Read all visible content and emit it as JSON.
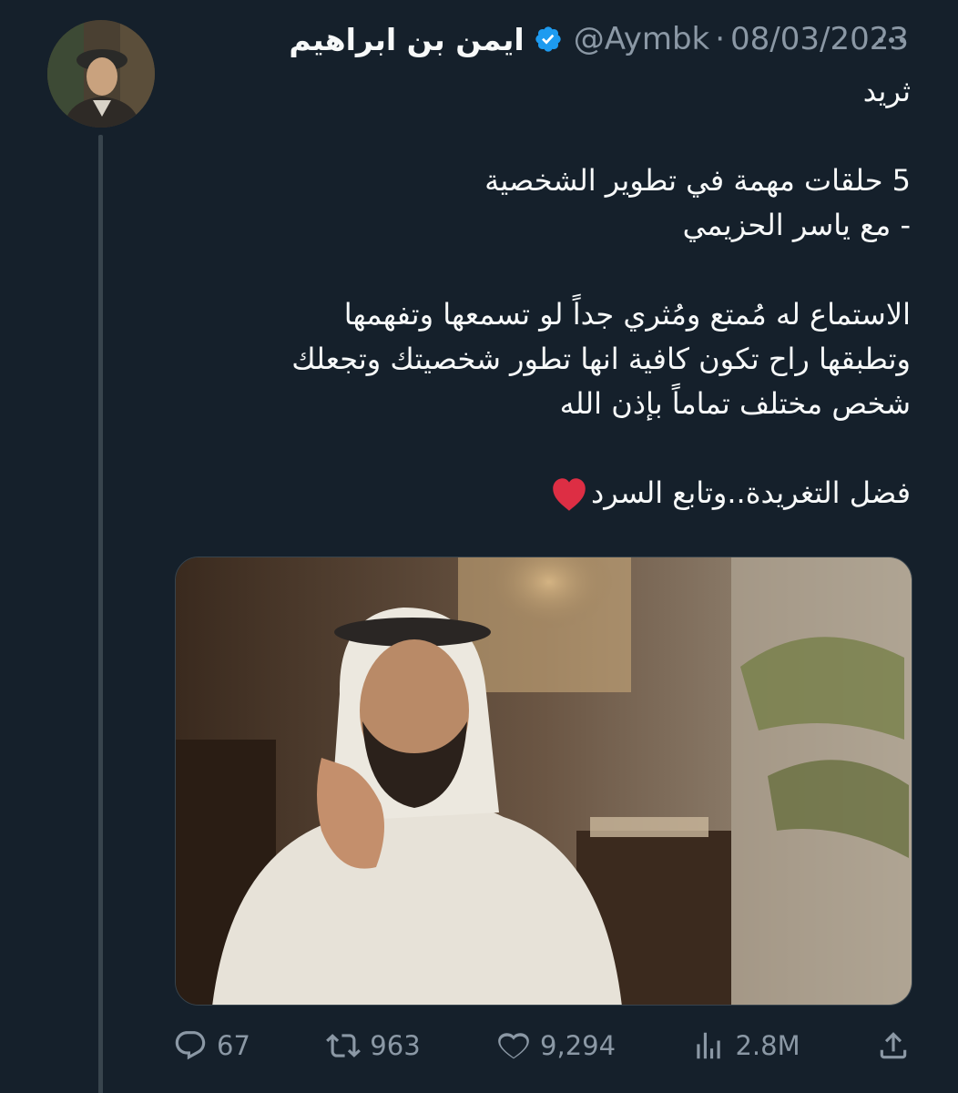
{
  "tweet": {
    "author_name": "ايمن بن ابراهيم",
    "handle": "@Aymbk",
    "separator": "·",
    "date": "08/03/2023",
    "lines": [
      "ثريد",
      "",
      "5 حلقات مهمة في تطوير الشخصية",
      "- مع ياسر الحزيمي",
      "",
      "الاستماع له مُمتع ومُثري جداً لو تسمعها وتفهمها",
      "وتطبقها راح تكون كافية انها تطور شخصيتك وتجعلك",
      "شخص مختلف تماماً بإذن الله",
      "",
      "فضل التغريدة..وتابع السرد"
    ],
    "icons": {
      "verified": "verified-badge-icon",
      "more": "more-dots-icon",
      "heart_emoji": "red-heart-emoji"
    }
  },
  "actions": {
    "replies": "67",
    "retweets": "963",
    "likes": "9,294",
    "views": "2.8M",
    "icons": [
      "reply-icon",
      "retweet-icon",
      "like-icon",
      "views-icon",
      "share-icon"
    ]
  },
  "colors": {
    "background": "#15202b",
    "text": "#f7f9f9",
    "muted": "#8b98a5",
    "verified": "#1d9bf0",
    "heart": "#dd2e44"
  }
}
